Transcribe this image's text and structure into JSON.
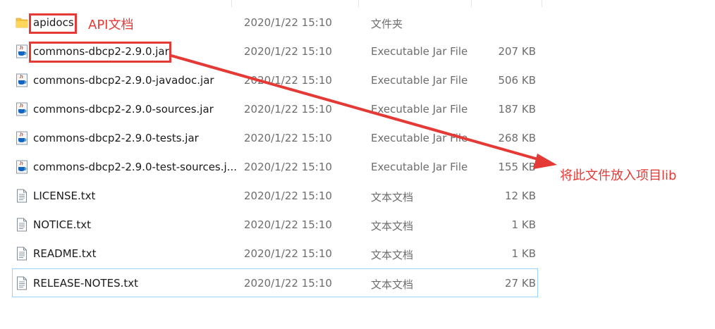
{
  "files": [
    {
      "name": "apidocs",
      "date": "2020/1/22 15:10",
      "type": "文件夹",
      "size": "",
      "icon": "folder-icon"
    },
    {
      "name": "commons-dbcp2-2.9.0.jar",
      "date": "2020/1/22 15:10",
      "type": "Executable Jar File",
      "size": "207 KB",
      "icon": "jar-file-icon"
    },
    {
      "name": "commons-dbcp2-2.9.0-javadoc.jar",
      "date": "2020/1/22 15:10",
      "type": "Executable Jar File",
      "size": "506 KB",
      "icon": "jar-file-icon"
    },
    {
      "name": "commons-dbcp2-2.9.0-sources.jar",
      "date": "2020/1/22 15:10",
      "type": "Executable Jar File",
      "size": "187 KB",
      "icon": "jar-file-icon"
    },
    {
      "name": "commons-dbcp2-2.9.0-tests.jar",
      "date": "2020/1/22 15:10",
      "type": "Executable Jar File",
      "size": "268 KB",
      "icon": "jar-file-icon"
    },
    {
      "name": "commons-dbcp2-2.9.0-test-sources.j...",
      "date": "2020/1/22 15:10",
      "type": "Executable Jar File",
      "size": "155 KB",
      "icon": "jar-file-icon"
    },
    {
      "name": "LICENSE.txt",
      "date": "2020/1/22 15:10",
      "type": "文本文档",
      "size": "12 KB",
      "icon": "text-file-icon"
    },
    {
      "name": "NOTICE.txt",
      "date": "2020/1/22 15:10",
      "type": "文本文档",
      "size": "1 KB",
      "icon": "text-file-icon"
    },
    {
      "name": "README.txt",
      "date": "2020/1/22 15:10",
      "type": "文本文档",
      "size": "1 KB",
      "icon": "text-file-icon"
    },
    {
      "name": "RELEASE-NOTES.txt",
      "date": "2020/1/22 15:10",
      "type": "文本文档",
      "size": "27 KB",
      "icon": "text-file-icon"
    }
  ],
  "annotations": {
    "api_label": "API文档",
    "put_in_lib_label": "将此文件放入项目lib",
    "color": "#e53935"
  },
  "colors": {
    "selection_border": "#99d1ff",
    "folder": "#f5c342",
    "secondary_text": "#6d6d6d"
  }
}
